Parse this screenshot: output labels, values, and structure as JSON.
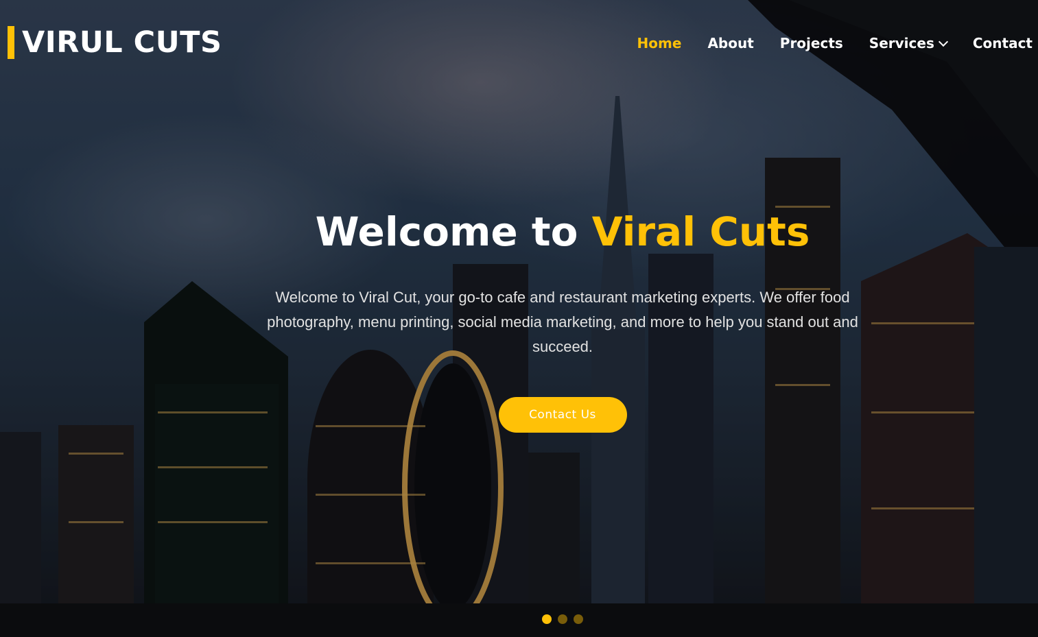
{
  "brand": {
    "logo_text": "VIRUL CUTS",
    "accent_color": "#ffc107"
  },
  "nav": {
    "items": [
      {
        "label": "Home",
        "active": true
      },
      {
        "label": "About",
        "active": false
      },
      {
        "label": "Projects",
        "active": false
      },
      {
        "label": "Services",
        "active": false,
        "has_dropdown": true
      },
      {
        "label": "Contact",
        "active": false
      }
    ]
  },
  "hero": {
    "title_prefix": "Welcome to ",
    "title_highlight": "Viral Cuts",
    "description": "Welcome to Viral Cut, your go-to cafe and restaurant marketing experts. We offer food photography, menu printing, social media marketing, and more to help you stand out and succeed.",
    "cta_label": "Contact Us",
    "background": "night city skyline photo with skyscrapers",
    "slides": [
      {
        "active": true
      },
      {
        "active": false
      },
      {
        "active": false
      }
    ]
  },
  "icons": {
    "dropdown": "chevron-down-icon"
  }
}
